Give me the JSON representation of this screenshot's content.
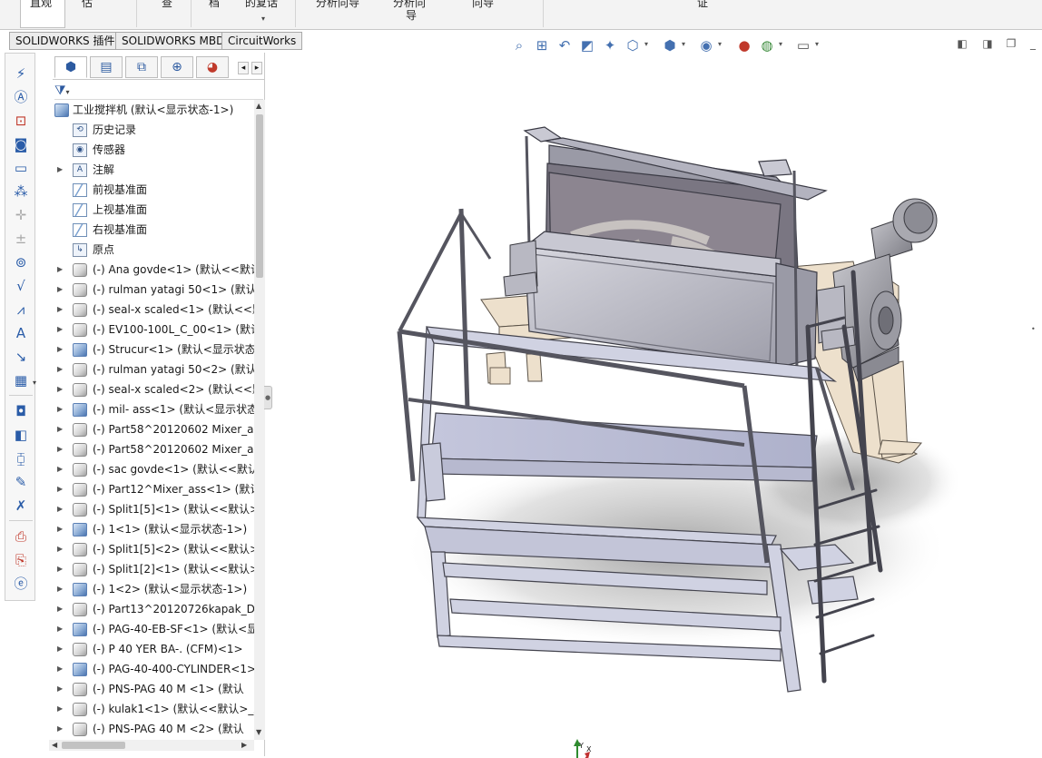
{
  "ribbon": {
    "items": [
      {
        "label": "直观"
      },
      {
        "label": "估"
      },
      {
        "label": "查"
      },
      {
        "label": "档"
      },
      {
        "label": "的复话"
      },
      {
        "label": "分析向导"
      },
      {
        "label": "分析向"
      },
      {
        "label": "导"
      },
      {
        "label": "向导"
      },
      {
        "label": "证"
      }
    ]
  },
  "tabs": [
    {
      "label": "SOLIDWORKS 插件"
    },
    {
      "label": "SOLIDWORKS MBD"
    },
    {
      "label": "CircuitWorks"
    }
  ],
  "featuremanager": {
    "root": "工业搅拌机  (默认<显示状态-1>)",
    "items": [
      {
        "label": "历史记录",
        "icon": "history-icon",
        "toggle": false
      },
      {
        "label": "传感器",
        "icon": "sensor-icon",
        "toggle": false
      },
      {
        "label": "注解",
        "icon": "annotation-icon",
        "toggle": true
      },
      {
        "label": "前视基准面",
        "icon": "plane-icon",
        "toggle": false
      },
      {
        "label": "上视基准面",
        "icon": "plane-icon",
        "toggle": false
      },
      {
        "label": "右视基准面",
        "icon": "plane-icon",
        "toggle": false
      },
      {
        "label": "原点",
        "icon": "origin-icon",
        "toggle": false
      },
      {
        "label": "(-) Ana govde<1> (默认<<默认",
        "icon": "part-icon",
        "toggle": true
      },
      {
        "label": "(-) rulman yatagi 50<1> (默认",
        "icon": "part-icon",
        "toggle": true
      },
      {
        "label": "(-) seal-x scaled<1> (默认<<默",
        "icon": "part-icon",
        "toggle": true
      },
      {
        "label": "(-) EV100-100L_C_00<1> (默认",
        "icon": "part-icon",
        "toggle": true
      },
      {
        "label": "(-) Strucur<1> (默认<显示状态",
        "icon": "assembly-icon",
        "toggle": true
      },
      {
        "label": "(-) rulman yatagi 50<2> (默认",
        "icon": "part-icon",
        "toggle": true
      },
      {
        "label": "(-) seal-x scaled<2> (默认<<默",
        "icon": "part-icon",
        "toggle": true
      },
      {
        "label": "(-) mil- ass<1> (默认<显示状态",
        "icon": "assembly-icon",
        "toggle": true
      },
      {
        "label": "(-) Part58^20120602 Mixer_as",
        "icon": "part-icon",
        "toggle": true
      },
      {
        "label": "(-) Part58^20120602 Mixer_as",
        "icon": "part-icon",
        "toggle": true
      },
      {
        "label": "(-) sac govde<1> (默认<<默认",
        "icon": "part-icon",
        "toggle": true
      },
      {
        "label": "(-) Part12^Mixer_ass<1> (默认",
        "icon": "part-icon",
        "toggle": true
      },
      {
        "label": "(-) Split1[5]<1> (默认<<默认>",
        "icon": "part-icon",
        "toggle": true
      },
      {
        "label": "(-) 1<1> (默认<显示状态-1>)",
        "icon": "assembly-icon",
        "toggle": true
      },
      {
        "label": "(-) Split1[5]<2> (默认<<默认>",
        "icon": "part-icon",
        "toggle": true
      },
      {
        "label": "(-) Split1[2]<1> (默认<<默认>",
        "icon": "part-icon",
        "toggle": true
      },
      {
        "label": "(-) 1<2> (默认<显示状态-1>)",
        "icon": "assembly-icon",
        "toggle": true
      },
      {
        "label": "(-) Part13^20120726kapak_De",
        "icon": "part-icon",
        "toggle": true
      },
      {
        "label": "(-) PAG-40-EB-SF<1> (默认<显",
        "icon": "assembly-icon",
        "toggle": true
      },
      {
        "label": "(-)     P 40 YER BA-. (CFM)<1>",
        "icon": "part-icon",
        "toggle": true
      },
      {
        "label": "(-) PAG-40-400-CYLINDER<1>",
        "icon": "assembly-icon",
        "toggle": true
      },
      {
        "label": "(-) PNS-PAG 40 M     <1> (默认",
        "icon": "part-icon",
        "toggle": true
      },
      {
        "label": "(-) kulak1<1> (默认<<默认>_显",
        "icon": "part-icon",
        "toggle": true
      },
      {
        "label": "(-) PNS-PAG 40 M     <2> (默认",
        "icon": "part-icon",
        "toggle": true
      }
    ]
  },
  "triad": {
    "x": "X",
    "y": "Y",
    "z": "Z"
  },
  "colors": {
    "accent": "#2c5aa0",
    "frame": "#c9cad8",
    "frame_edge": "#4a4a55",
    "tank": "#bcbcc8",
    "tank_inner": "#8a8590",
    "base": "#ede0cc",
    "motor": "#9d9da3"
  }
}
